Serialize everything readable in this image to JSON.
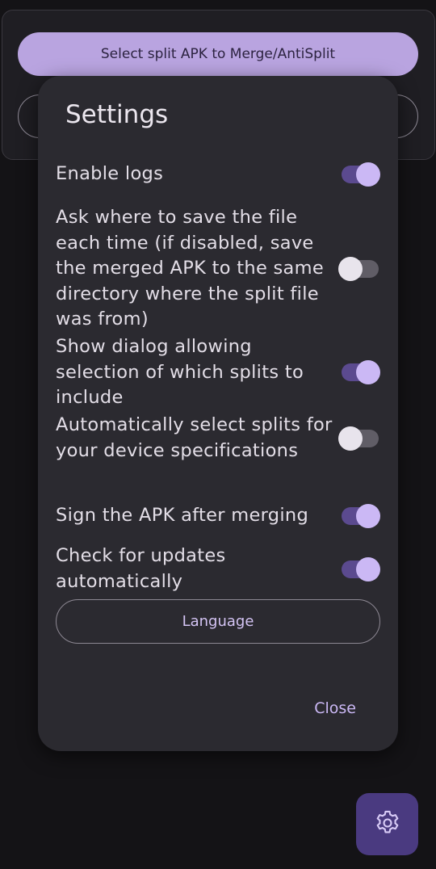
{
  "background": {
    "primary_button_label": "Select split APK to Merge/AntiSplit"
  },
  "dialog": {
    "title": "Settings",
    "settings": [
      {
        "label": "Enable logs",
        "enabled": true
      },
      {
        "label": "Ask where to save the file each time (if disabled, save the merged APK to the same directory where the split file was from)",
        "enabled": false
      },
      {
        "label": "Show dialog allowing selection of which splits to include",
        "enabled": true
      },
      {
        "label": "Automatically select splits for your device specifications",
        "enabled": false
      },
      {
        "label": "Sign the APK after merging",
        "enabled": true
      },
      {
        "label": "Check for updates automatically",
        "enabled": true
      }
    ],
    "language_label": "Language",
    "close_label": "Close"
  },
  "fab": {
    "icon": "gear-icon"
  },
  "colors": {
    "accent": "#cbb8f5",
    "primary_button": "#b9a4e0",
    "dialog_bg": "#2b2a30",
    "fab_bg": "#4a3a80"
  }
}
